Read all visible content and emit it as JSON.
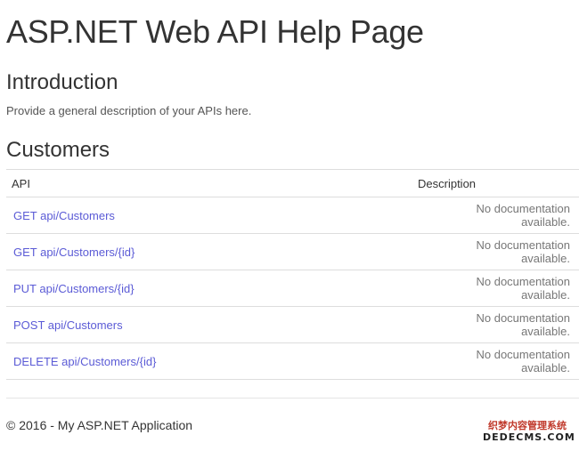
{
  "header": {
    "title": "ASP.NET Web API Help Page"
  },
  "introduction": {
    "heading": "Introduction",
    "text": "Provide a general description of your APIs here."
  },
  "customers": {
    "heading": "Customers",
    "columns": [
      "API",
      "Description"
    ],
    "rows": [
      {
        "api": "GET api/Customers",
        "description": "No documentation available."
      },
      {
        "api": "GET api/Customers/{id}",
        "description": "No documentation available."
      },
      {
        "api": "PUT api/Customers/{id}",
        "description": "No documentation available."
      },
      {
        "api": "POST api/Customers",
        "description": "No documentation available."
      },
      {
        "api": "DELETE api/Customers/{id}",
        "description": "No documentation available."
      }
    ]
  },
  "footer": {
    "text": "© 2016 - My ASP.NET Application"
  },
  "watermark": {
    "line1": "织梦内容管理系统",
    "line2": "DEDECMS.COM"
  },
  "colors": {
    "link": "#5b5bd6",
    "text": "#333333",
    "muted": "#777777",
    "border": "#dddddd"
  }
}
